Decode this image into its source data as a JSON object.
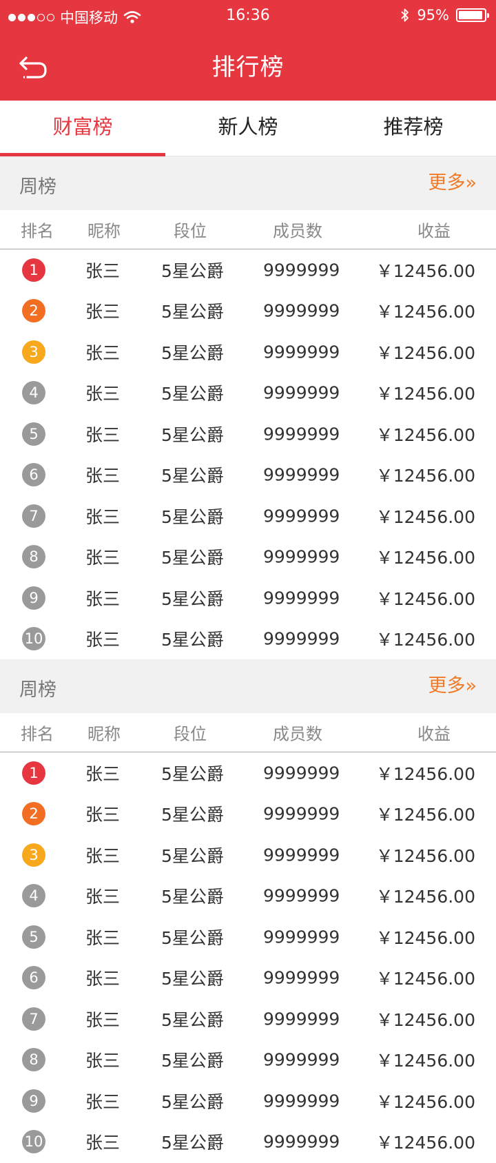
{
  "status_bar": {
    "carrier": "中国移动",
    "time": "16:36",
    "battery_percent": "95%",
    "battery_level": 0.95,
    "signal_bars_filled": 3,
    "signal_bars_total": 5
  },
  "nav": {
    "title": "排行榜",
    "back_icon": "back-arrow-icon"
  },
  "tabs": [
    {
      "label": "财富榜",
      "active": true
    },
    {
      "label": "新人榜",
      "active": false
    },
    {
      "label": "推荐榜",
      "active": false
    }
  ],
  "colors": {
    "brand": "#e63740",
    "more": "#f07a27",
    "rank_1": "#e63740",
    "rank_2": "#f26e22",
    "rank_3": "#f7a81c",
    "rank_other": "#9a9a9a"
  },
  "sections": [
    {
      "title": "周榜",
      "more": "更多»",
      "columns": {
        "rank": "排名",
        "nickname": "昵称",
        "level": "段位",
        "members": "成员数",
        "income": "收益"
      },
      "rows": [
        {
          "rank": "1",
          "nickname": "张三",
          "level": "5星公爵",
          "members": "9999999",
          "income": "￥12456.00"
        },
        {
          "rank": "2",
          "nickname": "张三",
          "level": "5星公爵",
          "members": "9999999",
          "income": "￥12456.00"
        },
        {
          "rank": "3",
          "nickname": "张三",
          "level": "5星公爵",
          "members": "9999999",
          "income": "￥12456.00"
        },
        {
          "rank": "4",
          "nickname": "张三",
          "level": "5星公爵",
          "members": "9999999",
          "income": "￥12456.00"
        },
        {
          "rank": "5",
          "nickname": "张三",
          "level": "5星公爵",
          "members": "9999999",
          "income": "￥12456.00"
        },
        {
          "rank": "6",
          "nickname": "张三",
          "level": "5星公爵",
          "members": "9999999",
          "income": "￥12456.00"
        },
        {
          "rank": "7",
          "nickname": "张三",
          "level": "5星公爵",
          "members": "9999999",
          "income": "￥12456.00"
        },
        {
          "rank": "8",
          "nickname": "张三",
          "level": "5星公爵",
          "members": "9999999",
          "income": "￥12456.00"
        },
        {
          "rank": "9",
          "nickname": "张三",
          "level": "5星公爵",
          "members": "9999999",
          "income": "￥12456.00"
        },
        {
          "rank": "10",
          "nickname": "张三",
          "level": "5星公爵",
          "members": "9999999",
          "income": "￥12456.00"
        }
      ]
    },
    {
      "title": "周榜",
      "more": "更多»",
      "columns": {
        "rank": "排名",
        "nickname": "昵称",
        "level": "段位",
        "members": "成员数",
        "income": "收益"
      },
      "rows": [
        {
          "rank": "1",
          "nickname": "张三",
          "level": "5星公爵",
          "members": "9999999",
          "income": "￥12456.00"
        },
        {
          "rank": "2",
          "nickname": "张三",
          "level": "5星公爵",
          "members": "9999999",
          "income": "￥12456.00"
        },
        {
          "rank": "3",
          "nickname": "张三",
          "level": "5星公爵",
          "members": "9999999",
          "income": "￥12456.00"
        },
        {
          "rank": "4",
          "nickname": "张三",
          "level": "5星公爵",
          "members": "9999999",
          "income": "￥12456.00"
        },
        {
          "rank": "5",
          "nickname": "张三",
          "level": "5星公爵",
          "members": "9999999",
          "income": "￥12456.00"
        },
        {
          "rank": "6",
          "nickname": "张三",
          "level": "5星公爵",
          "members": "9999999",
          "income": "￥12456.00"
        },
        {
          "rank": "7",
          "nickname": "张三",
          "level": "5星公爵",
          "members": "9999999",
          "income": "￥12456.00"
        },
        {
          "rank": "8",
          "nickname": "张三",
          "level": "5星公爵",
          "members": "9999999",
          "income": "￥12456.00"
        },
        {
          "rank": "9",
          "nickname": "张三",
          "level": "5星公爵",
          "members": "9999999",
          "income": "￥12456.00"
        },
        {
          "rank": "10",
          "nickname": "张三",
          "level": "5星公爵",
          "members": "9999999",
          "income": "￥12456.00"
        }
      ]
    }
  ]
}
